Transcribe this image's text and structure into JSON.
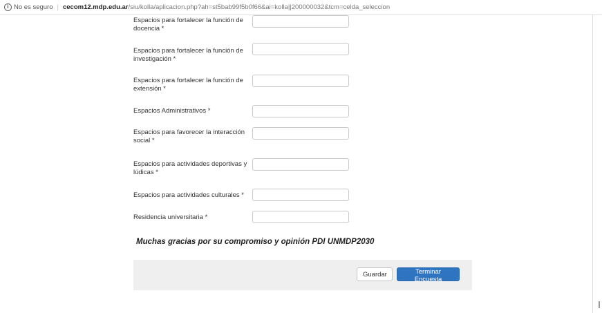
{
  "address_bar": {
    "security_text": "No es seguro",
    "url_host": "cecom12.mdp.edu.ar",
    "url_path": "/siu/kolla/aplicacion.php?ah=st5bab99f5b0f66&ai=kolla||200000032&tcm=celda_seleccion"
  },
  "form": {
    "rows": [
      {
        "label": "Espacios para fortalecer la función de docencia *",
        "value": ""
      },
      {
        "label": "Espacios para fortalecer la función de investigación *",
        "value": ""
      },
      {
        "label": "Espacios para fortalecer la función de extensión *",
        "value": ""
      },
      {
        "label": "Espacios Administrativos *",
        "value": ""
      },
      {
        "label": "Espacios para favorecer la interacción social *",
        "value": ""
      },
      {
        "label": "Espacios para actividades deportivas y lúdicas *",
        "value": ""
      },
      {
        "label": "Espacios para actividades culturales *",
        "value": ""
      },
      {
        "label": "Residencia universitaria *",
        "value": ""
      }
    ]
  },
  "thanks_message": "Muchas gracias por su compromiso y opinión PDI UNMDP2030",
  "footer": {
    "save_label": "Guardar",
    "finish_label": "Terminar Encuesta"
  }
}
